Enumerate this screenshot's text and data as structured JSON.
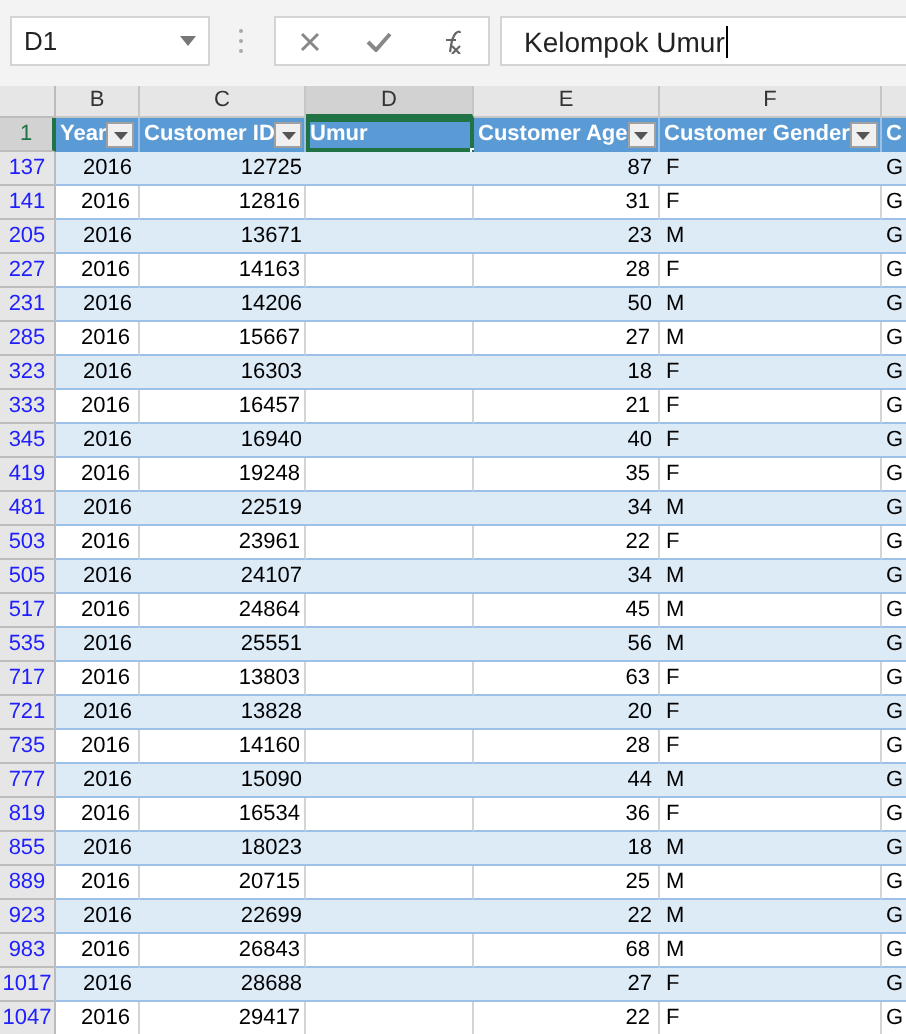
{
  "name_box": "D1",
  "formula": "Kelompok Umur",
  "column_headers": [
    {
      "label": "B",
      "selected": false
    },
    {
      "label": "C",
      "selected": false
    },
    {
      "label": "D",
      "selected": true
    },
    {
      "label": "E",
      "selected": false
    },
    {
      "label": "F",
      "selected": false
    }
  ],
  "header_row": {
    "number": "1",
    "cells": [
      {
        "label": "Year",
        "filter": true,
        "selected": false
      },
      {
        "label": "Customer ID",
        "filter": true,
        "selected": false
      },
      {
        "label": "Umur",
        "filter": false,
        "selected": true
      },
      {
        "label": "Customer Age",
        "filter": true,
        "selected": false
      },
      {
        "label": "Customer Gender",
        "filter": true,
        "selected": false
      },
      {
        "label": "C",
        "filter": false,
        "selected": false
      }
    ]
  },
  "rows": [
    {
      "number": "137",
      "year": "2016",
      "customer_id": "12725",
      "age": "87",
      "gender": "F",
      "column_g": "G"
    },
    {
      "number": "141",
      "year": "2016",
      "customer_id": "12816",
      "age": "31",
      "gender": "F",
      "column_g": "G"
    },
    {
      "number": "205",
      "year": "2016",
      "customer_id": "13671",
      "age": "23",
      "gender": "M",
      "column_g": "G"
    },
    {
      "number": "227",
      "year": "2016",
      "customer_id": "14163",
      "age": "28",
      "gender": "F",
      "column_g": "G"
    },
    {
      "number": "231",
      "year": "2016",
      "customer_id": "14206",
      "age": "50",
      "gender": "M",
      "column_g": "G"
    },
    {
      "number": "285",
      "year": "2016",
      "customer_id": "15667",
      "age": "27",
      "gender": "M",
      "column_g": "G"
    },
    {
      "number": "323",
      "year": "2016",
      "customer_id": "16303",
      "age": "18",
      "gender": "F",
      "column_g": "G"
    },
    {
      "number": "333",
      "year": "2016",
      "customer_id": "16457",
      "age": "21",
      "gender": "F",
      "column_g": "G"
    },
    {
      "number": "345",
      "year": "2016",
      "customer_id": "16940",
      "age": "40",
      "gender": "F",
      "column_g": "G"
    },
    {
      "number": "419",
      "year": "2016",
      "customer_id": "19248",
      "age": "35",
      "gender": "F",
      "column_g": "G"
    },
    {
      "number": "481",
      "year": "2016",
      "customer_id": "22519",
      "age": "34",
      "gender": "M",
      "column_g": "G"
    },
    {
      "number": "503",
      "year": "2016",
      "customer_id": "23961",
      "age": "22",
      "gender": "F",
      "column_g": "G"
    },
    {
      "number": "505",
      "year": "2016",
      "customer_id": "24107",
      "age": "34",
      "gender": "M",
      "column_g": "G"
    },
    {
      "number": "517",
      "year": "2016",
      "customer_id": "24864",
      "age": "45",
      "gender": "M",
      "column_g": "G"
    },
    {
      "number": "535",
      "year": "2016",
      "customer_id": "25551",
      "age": "56",
      "gender": "M",
      "column_g": "G"
    },
    {
      "number": "717",
      "year": "2016",
      "customer_id": "13803",
      "age": "63",
      "gender": "F",
      "column_g": "G"
    },
    {
      "number": "721",
      "year": "2016",
      "customer_id": "13828",
      "age": "20",
      "gender": "F",
      "column_g": "G"
    },
    {
      "number": "735",
      "year": "2016",
      "customer_id": "14160",
      "age": "28",
      "gender": "F",
      "column_g": "G"
    },
    {
      "number": "777",
      "year": "2016",
      "customer_id": "15090",
      "age": "44",
      "gender": "M",
      "column_g": "G"
    },
    {
      "number": "819",
      "year": "2016",
      "customer_id": "16534",
      "age": "36",
      "gender": "F",
      "column_g": "G"
    },
    {
      "number": "855",
      "year": "2016",
      "customer_id": "18023",
      "age": "18",
      "gender": "M",
      "column_g": "G"
    },
    {
      "number": "889",
      "year": "2016",
      "customer_id": "20715",
      "age": "25",
      "gender": "M",
      "column_g": "G"
    },
    {
      "number": "923",
      "year": "2016",
      "customer_id": "22699",
      "age": "22",
      "gender": "M",
      "column_g": "G"
    },
    {
      "number": "983",
      "year": "2016",
      "customer_id": "26843",
      "age": "68",
      "gender": "M",
      "column_g": "G"
    },
    {
      "number": "1017",
      "year": "2016",
      "customer_id": "28688",
      "age": "27",
      "gender": "F",
      "column_g": "G"
    },
    {
      "number": "1047",
      "year": "2016",
      "customer_id": "29417",
      "age": "22",
      "gender": "F",
      "column_g": "G"
    }
  ]
}
